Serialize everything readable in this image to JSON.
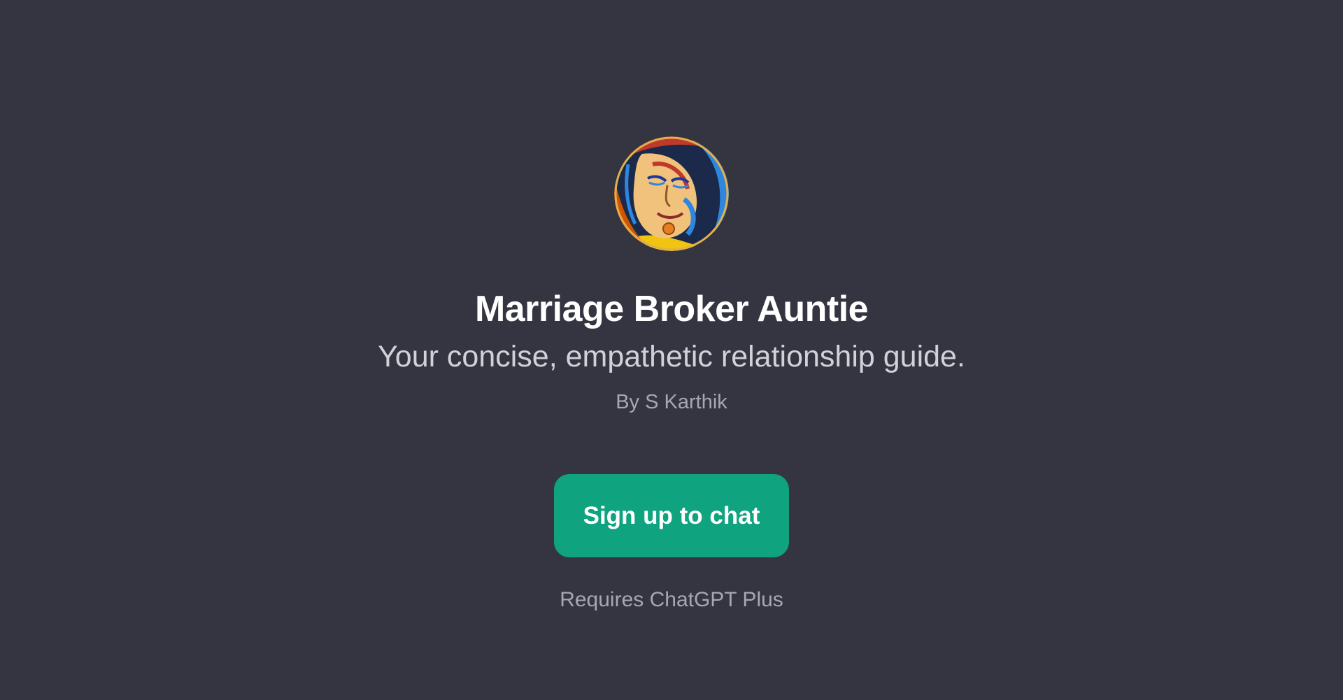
{
  "gpt": {
    "avatar_icon": "stylized-face-avatar-icon",
    "name": "Marriage Broker Auntie",
    "description": "Your concise, empathetic relationship guide.",
    "author": "By S Karthik"
  },
  "cta": {
    "label": "Sign up to chat"
  },
  "note": "Requires ChatGPT Plus",
  "colors": {
    "background": "#343541",
    "button": "#10a37f",
    "title": "#ffffff",
    "subtitle": "#d1d2d9",
    "muted": "#a6a7b1"
  }
}
